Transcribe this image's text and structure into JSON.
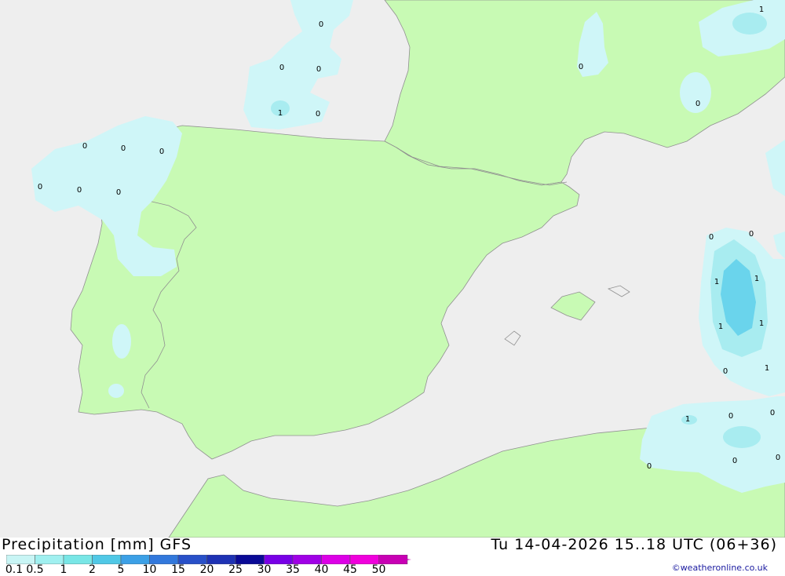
{
  "header": {
    "title_left": "Precipitation [mm] GFS",
    "title_right": "Tu 14-04-2026 15..18 UTC (06+36)"
  },
  "legend": {
    "ticks": [
      "0.1",
      "0.5",
      "1",
      "2",
      "5",
      "10",
      "15",
      "20",
      "25",
      "30",
      "35",
      "40",
      "45",
      "50"
    ],
    "colors": [
      "#c8f5f5",
      "#a0f0f0",
      "#78e6e6",
      "#50c8e6",
      "#3ca0e6",
      "#3278dc",
      "#2850c8",
      "#1e32b4",
      "#0a0a96",
      "#7800e6",
      "#a000e6",
      "#dc00e6",
      "#f000dc",
      "#c800b4"
    ]
  },
  "map_labels": [
    "0",
    "0",
    "0",
    "1",
    "0",
    "0",
    "0",
    "0",
    "0",
    "0",
    "0",
    "0",
    "0",
    "1",
    "0",
    "0",
    "1",
    "1",
    "1",
    "1",
    "0",
    "1",
    "1",
    "0",
    "0",
    "0",
    "0",
    "0"
  ],
  "credit": "©weatheronline.co.uk",
  "colors": {
    "land": "#c8fab4",
    "sea": "#eeeeee",
    "border": "#909090",
    "precip_light": "#cff6f8",
    "precip_mid": "#a8ecf0",
    "precip_high": "#6ad4ec"
  }
}
